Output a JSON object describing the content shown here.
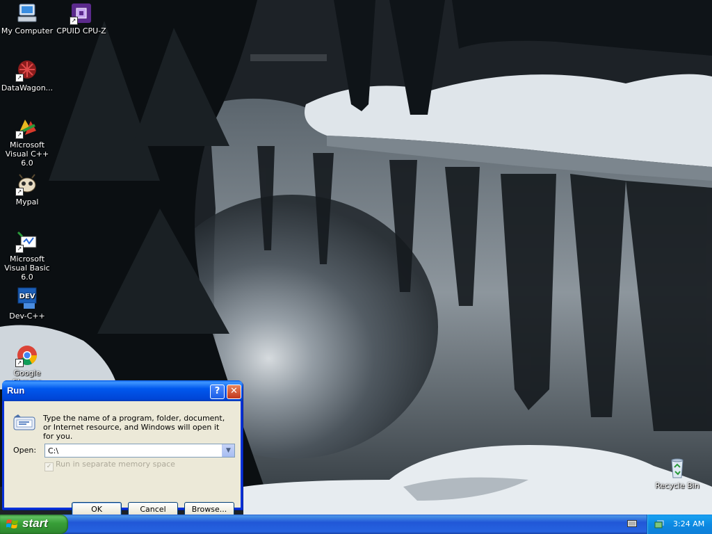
{
  "desktop": {
    "icons": [
      {
        "label": "My Computer"
      },
      {
        "label": "CPUID CPU-Z"
      },
      {
        "label": "DataWagon..."
      },
      {
        "label": "Microsoft Visual C++ 6.0"
      },
      {
        "label": "Mypal"
      },
      {
        "label": "Microsoft Visual Basic 6.0"
      },
      {
        "label": "Dev-C++"
      },
      {
        "label": "Google Chrome"
      },
      {
        "label": "Recycle Bin"
      }
    ]
  },
  "run_dialog": {
    "title": "Run",
    "help_glyph": "?",
    "close_glyph": "✕",
    "description": "Type the name of a program, folder, document, or Internet resource, and Windows will open it for you.",
    "open_label": "Open:",
    "open_value": "C:\\",
    "separate_memory_label": "Run in separate memory space",
    "ok_label": "OK",
    "cancel_label": "Cancel",
    "browse_label": "Browse..."
  },
  "taskbar": {
    "start_label": "start",
    "clock": "3:24 AM"
  },
  "colors": {
    "titlebar_blue": "#0058ee",
    "start_green": "#379e37",
    "tray_blue": "#0c8ae3",
    "dialog_face": "#ece9d8"
  }
}
